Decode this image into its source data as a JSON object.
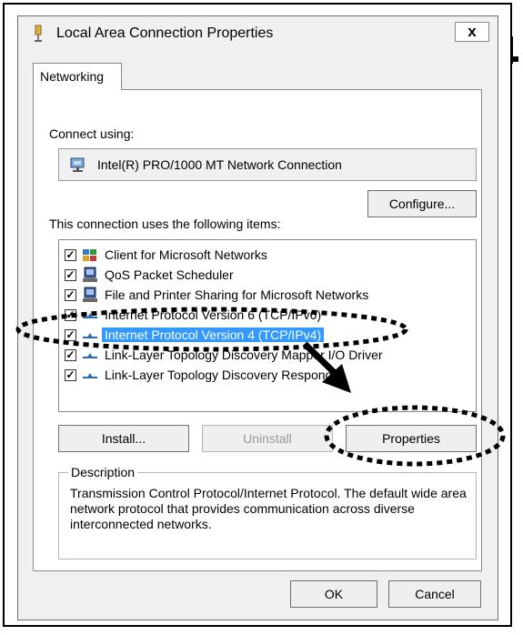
{
  "window": {
    "title": "Local Area Connection Properties",
    "close_label": "x"
  },
  "tabs": [
    {
      "label": "Networking",
      "selected": true
    }
  ],
  "connect": {
    "label": "Connect using:",
    "adapter": "Intel(R) PRO/1000 MT Network Connection",
    "configure_label": "Configure..."
  },
  "items_label": "This connection uses the following items:",
  "items": [
    {
      "label": "Client for Microsoft Networks",
      "checked": true,
      "icon": "network-client-icon",
      "selected": false
    },
    {
      "label": "QoS Packet Scheduler",
      "checked": true,
      "icon": "computer-service-icon",
      "selected": false
    },
    {
      "label": "File and Printer Sharing for Microsoft Networks",
      "checked": true,
      "icon": "computer-service-icon",
      "selected": false
    },
    {
      "label": "Internet Protocol Version 6 (TCP/IPv6)",
      "checked": true,
      "icon": "protocol-icon",
      "selected": false
    },
    {
      "label": "Internet Protocol Version 4 (TCP/IPv4)",
      "checked": true,
      "icon": "protocol-icon",
      "selected": true
    },
    {
      "label": "Link-Layer Topology Discovery Mapper I/O Driver",
      "checked": true,
      "icon": "protocol-icon",
      "selected": false
    },
    {
      "label": "Link-Layer Topology Discovery Responder",
      "checked": true,
      "icon": "protocol-icon",
      "selected": false
    }
  ],
  "buttons": {
    "install": "Install...",
    "uninstall": "Uninstall",
    "properties": "Properties",
    "ok": "OK",
    "cancel": "Cancel"
  },
  "description": {
    "legend": "Description",
    "text": "Transmission Control Protocol/Internet Protocol. The default wide area network protocol that provides communication across diverse interconnected networks."
  },
  "colors": {
    "selection": "#3399ff",
    "dialog_bg": "#f0f0f0"
  }
}
